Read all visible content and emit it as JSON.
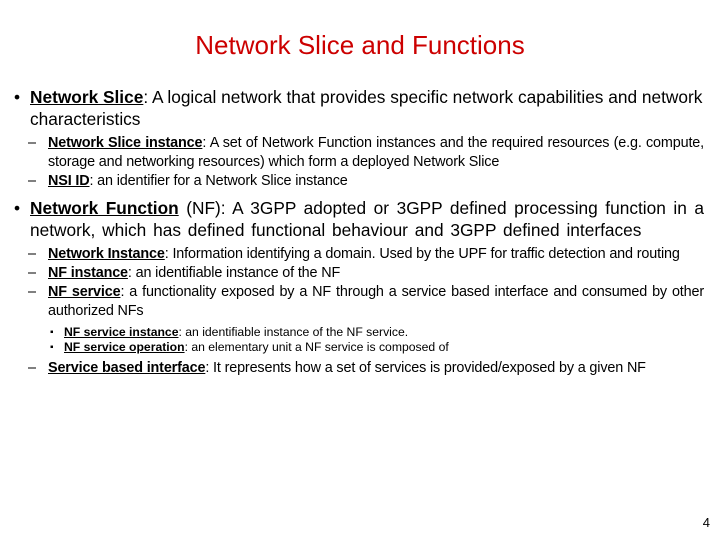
{
  "slide": {
    "title": "Network Slice and Functions",
    "title_color": "#cc0000",
    "page_number": "4"
  },
  "bullets": [
    {
      "term": "Network Slice",
      "text": ": A logical network that provides specific network capabilities and network characteristics",
      "sub": [
        {
          "term": "Network Slice instance",
          "text": ": A set of Network Function instances and the required resources (e.g. compute, storage and networking resources) which form a deployed Network Slice"
        },
        {
          "term": "NSI ID",
          "text": ": an identifier for a Network Slice instance"
        }
      ]
    },
    {
      "term": "Network Function",
      "text": " (NF): A 3GPP adopted or 3GPP defined processing function in a network, which has defined functional behaviour and 3GPP defined interfaces",
      "sub": [
        {
          "term": "Network Instance",
          "text": ": Information identifying a domain. Used by the UPF for traffic detection and routing"
        },
        {
          "term": "NF instance",
          "text": ": an identifiable instance of the NF"
        },
        {
          "term": "NF service",
          "text": ": a functionality exposed by a NF through a service based interface and consumed by other authorized NFs",
          "sub": [
            {
              "term": "NF service instance",
              "text": ": an identifiable instance of the NF service."
            },
            {
              "term": "NF service operation",
              "text": ": an elementary unit a NF service is composed of"
            }
          ]
        },
        {
          "term": "Service based interface",
          "text": ": It represents how a set of services is provided/exposed by a given NF"
        }
      ]
    }
  ],
  "glyphs": {
    "bullet": "•",
    "dash": "–",
    "small_bullet": "▪"
  }
}
